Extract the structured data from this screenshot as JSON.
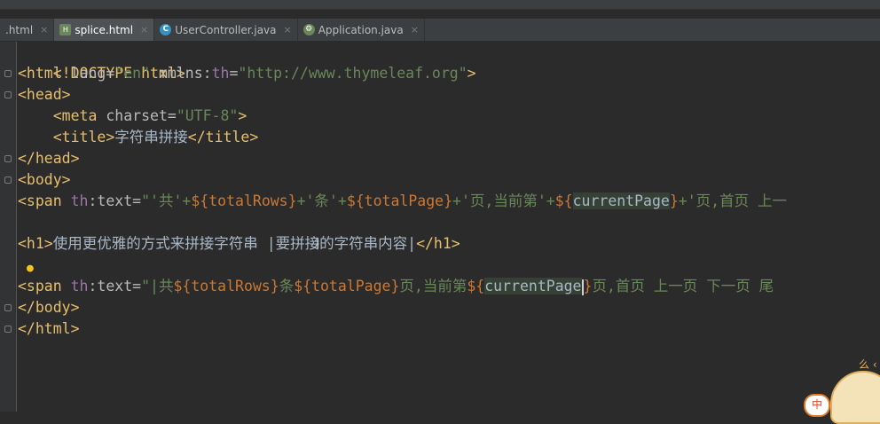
{
  "tabs": [
    {
      "label": ".html",
      "icon": "none",
      "close": "×",
      "active": false
    },
    {
      "label": "splice.html",
      "icon": "html-file-icon",
      "close": "×",
      "active": true
    },
    {
      "label": "UserController.java",
      "icon": "java-class-icon",
      "close": "×",
      "active": false
    },
    {
      "label": "Application.java",
      "icon": "spring-app-icon",
      "close": "×",
      "active": false
    }
  ],
  "code": {
    "l1": {
      "t": "<!DOCTYPE html>"
    },
    "l2": {
      "a": "<html",
      "b": " lang=",
      "c": "\"en\"",
      "d": " xmlns:",
      "e": "th",
      "f": "=",
      "g": "\"http://www.thymeleaf.org\"",
      "h": ">"
    },
    "l3": {
      "a": "<head>"
    },
    "l4": {
      "a": "    <meta",
      "b": " charset=",
      "c": "\"UTF-8\"",
      "d": ">"
    },
    "l5": {
      "a": "    <title>",
      "b": "字符串拼接",
      "c": "</title>"
    },
    "l6": {
      "a": "</head>"
    },
    "l7": {
      "a": "<body>"
    },
    "l8": {
      "a": "<span",
      "b": " th",
      "c": ":text=",
      "d": "\"'共'+",
      "e": "${totalRows}",
      "f": "+'条'+",
      "g": "${totalPage}",
      "h": "+'页,当前第'+",
      "i": "${",
      "j": "currentPage",
      "k": "}",
      "l": "+'页,首页 上一"
    },
    "l10": {
      "a": "<h1>",
      "b": "使用更优雅的方式来拼接字符串 ",
      "c": "|要拼接的字符串内容|",
      "d": "</h1>"
    },
    "l12": {
      "a": "<span",
      "b": " th",
      "c": ":text=",
      "d": "\"|共",
      "e": "${totalRows}",
      "f": "条",
      "g": "${totalPage}",
      "h": "页,当前第",
      "i": "${",
      "j": "currentPage",
      "k": "}",
      "l": "页,首页 上一页 下一页 尾"
    },
    "l13": {
      "a": "</body>"
    },
    "l14": {
      "a": "</html>"
    }
  },
  "overlay": {
    "ime_label": "中",
    "mascot_mark": "么 ‹"
  }
}
